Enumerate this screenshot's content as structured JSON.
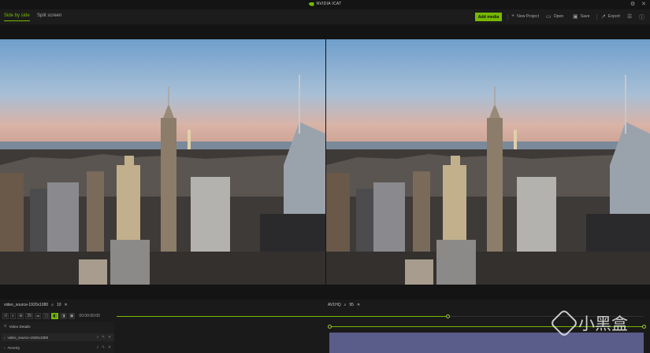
{
  "app": {
    "brand": "NVIDIA ICAT",
    "window_controls": [
      "⚙",
      "✕"
    ]
  },
  "tabs": [
    {
      "label": "Side by side",
      "active": true
    },
    {
      "label": "Split screen",
      "active": false
    }
  ],
  "toolbar": {
    "add_media": "Add media",
    "new_project": "New Project",
    "open": "Open",
    "save": "Save",
    "export": "Export"
  },
  "media": {
    "left_info": "video_source-1920x1080",
    "left_zoom": "10",
    "right_info": "AV1HQ",
    "right_zoom": "95"
  },
  "controls": {
    "items": [
      "↺",
      "◐",
      "⊕",
      "25",
      "⚌",
      "▢",
      "◧",
      "◨",
      "▣"
    ],
    "active_index": 6,
    "timecode": "00:00:00:00"
  },
  "playback": {
    "position": 0.63
  },
  "list": {
    "header": "Video Details",
    "rows": [
      {
        "label": "video_source-1920x1080",
        "selected": true
      },
      {
        "label": "AV1HQ",
        "selected": false
      }
    ]
  },
  "watermark": "小黑盒",
  "colors": {
    "accent": "#76b900",
    "clip": "#5a5c8a"
  }
}
